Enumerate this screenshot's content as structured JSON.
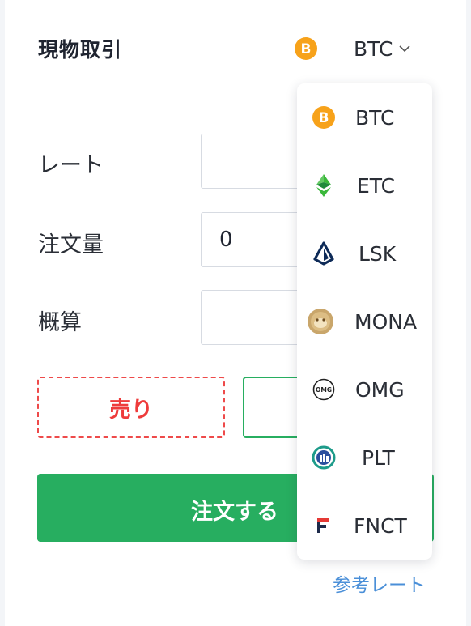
{
  "panel": {
    "title": "現物取引",
    "selected_coin": "BTC"
  },
  "form": {
    "rate_label": "レート",
    "rate_value": "",
    "amount_label": "注文量",
    "amount_value": "0",
    "estimate_label": "概算",
    "estimate_value": ""
  },
  "buttons": {
    "sell": "売り",
    "buy": "",
    "order": "注文する"
  },
  "reference_link": "参考レート",
  "coin_dropdown": {
    "items": [
      {
        "label": "BTC",
        "icon": "bitcoin-icon"
      },
      {
        "label": "ETC",
        "icon": "ethereum-classic-icon"
      },
      {
        "label": "LSK",
        "icon": "lisk-icon"
      },
      {
        "label": "MONA",
        "icon": "monacoin-icon"
      },
      {
        "label": "OMG",
        "icon": "omg-icon"
      },
      {
        "label": "PLT",
        "icon": "palette-token-icon"
      },
      {
        "label": "FNCT",
        "icon": "fnct-icon"
      }
    ]
  },
  "colors": {
    "accent_green": "#27ae60",
    "sell_red": "#ee3b3b",
    "link_blue": "#4a8fd8",
    "btc_orange": "#f7a21a"
  }
}
